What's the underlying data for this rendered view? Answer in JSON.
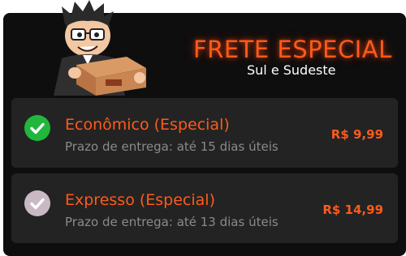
{
  "header": {
    "title": "FRETE ESPECIAL",
    "subtitle": "Sul e Sudeste"
  },
  "colors": {
    "accent": "#ff5a1a",
    "panel_bg": "#0e0e0e",
    "option_bg": "#232323",
    "selected_check": "#21b73c",
    "unselected_check": "#c9b9c2"
  },
  "options": [
    {
      "title": "Econômico (Especial)",
      "delivery": "Prazo de entrega: até 15 dias úteis",
      "price": "R$ 9,99",
      "selected": true
    },
    {
      "title": "Expresso (Especial)",
      "delivery": "Prazo de entrega: até 13 dias úteis",
      "price": "R$ 14,99",
      "selected": false
    }
  ]
}
